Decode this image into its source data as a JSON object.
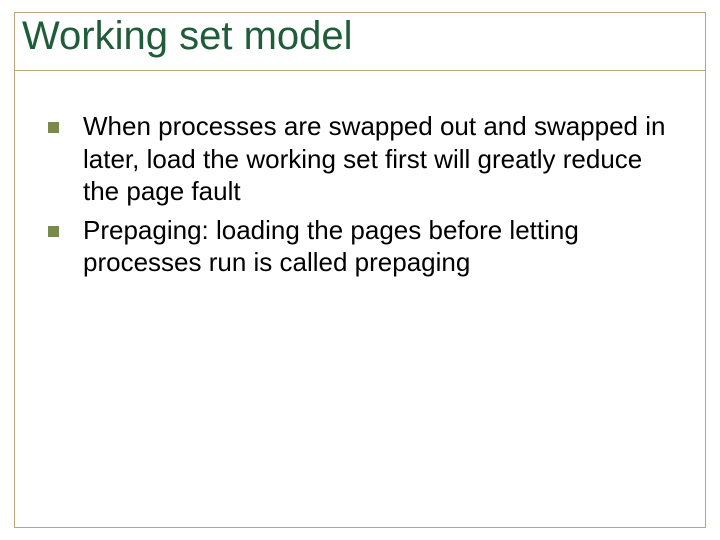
{
  "slide": {
    "title": "Working set model",
    "bullets": [
      {
        "text": "When processes are swapped out and swapped in later, load the working set first will greatly reduce the page fault"
      },
      {
        "text": "Prepaging: loading the pages before letting processes run is called prepaging"
      }
    ]
  },
  "colors": {
    "title": "#1f5c3a",
    "border": "#b9a77a",
    "bullet": "#7a8a4a"
  }
}
